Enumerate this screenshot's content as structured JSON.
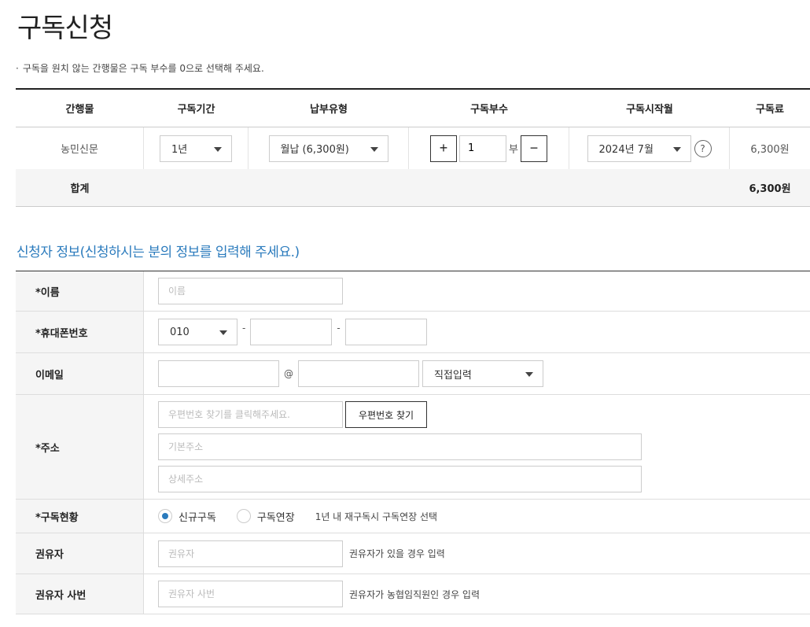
{
  "page": {
    "title": "구독신청",
    "notice": "구독을 원치 않는 간행물은 구독 부수를 0으로 선택해 주세요."
  },
  "subscription": {
    "headers": [
      "간행물",
      "구독기간",
      "납부유형",
      "구독부수",
      "구독시작월",
      "구독료"
    ],
    "row": {
      "publication": "농민신문",
      "period": "1년",
      "payment_type": "월납 (6,300원)",
      "quantity": "1",
      "quantity_unit": "부",
      "start_month": "2024년 7월",
      "fee": "6,300원"
    },
    "total_label": "합계",
    "total_value": "6,300원",
    "plus_glyph": "+",
    "minus_glyph": "−",
    "help_glyph": "?"
  },
  "applicant": {
    "section_title": "신청자 정보(신청하시는 분의 정보를 입력해 주세요.)",
    "name_label": "*이름",
    "name_placeholder": "이름",
    "phone_label": "*휴대폰번호",
    "phone_prefix": "010",
    "phone_sep": "-",
    "email_label": "이메일",
    "email_at": "@",
    "email_domain_select": "직접입력",
    "address_label": "*주소",
    "zipcode_placeholder": "우편번호 찾기를 클릭해주세요.",
    "zipcode_button": "우편번호 찾기",
    "address1_placeholder": "기본주소",
    "address2_placeholder": "상세주소",
    "status_label": "*구독현황",
    "status_new": "신규구독",
    "status_extend": "구독연장",
    "status_hint": "1년 내 재구독시 구독연장 선택",
    "recommender_label": "권유자",
    "recommender_placeholder": "권유자",
    "recommender_hint": "권유자가 있을 경우 입력",
    "recommender_id_label": "권유자 사번",
    "recommender_id_placeholder": "권유자 사번",
    "recommender_id_hint": "권유자가 농협임직원인 경우 입력"
  },
  "colors": {
    "accent": "#2b7bbd",
    "header_bg": "#f5f5f5"
  }
}
